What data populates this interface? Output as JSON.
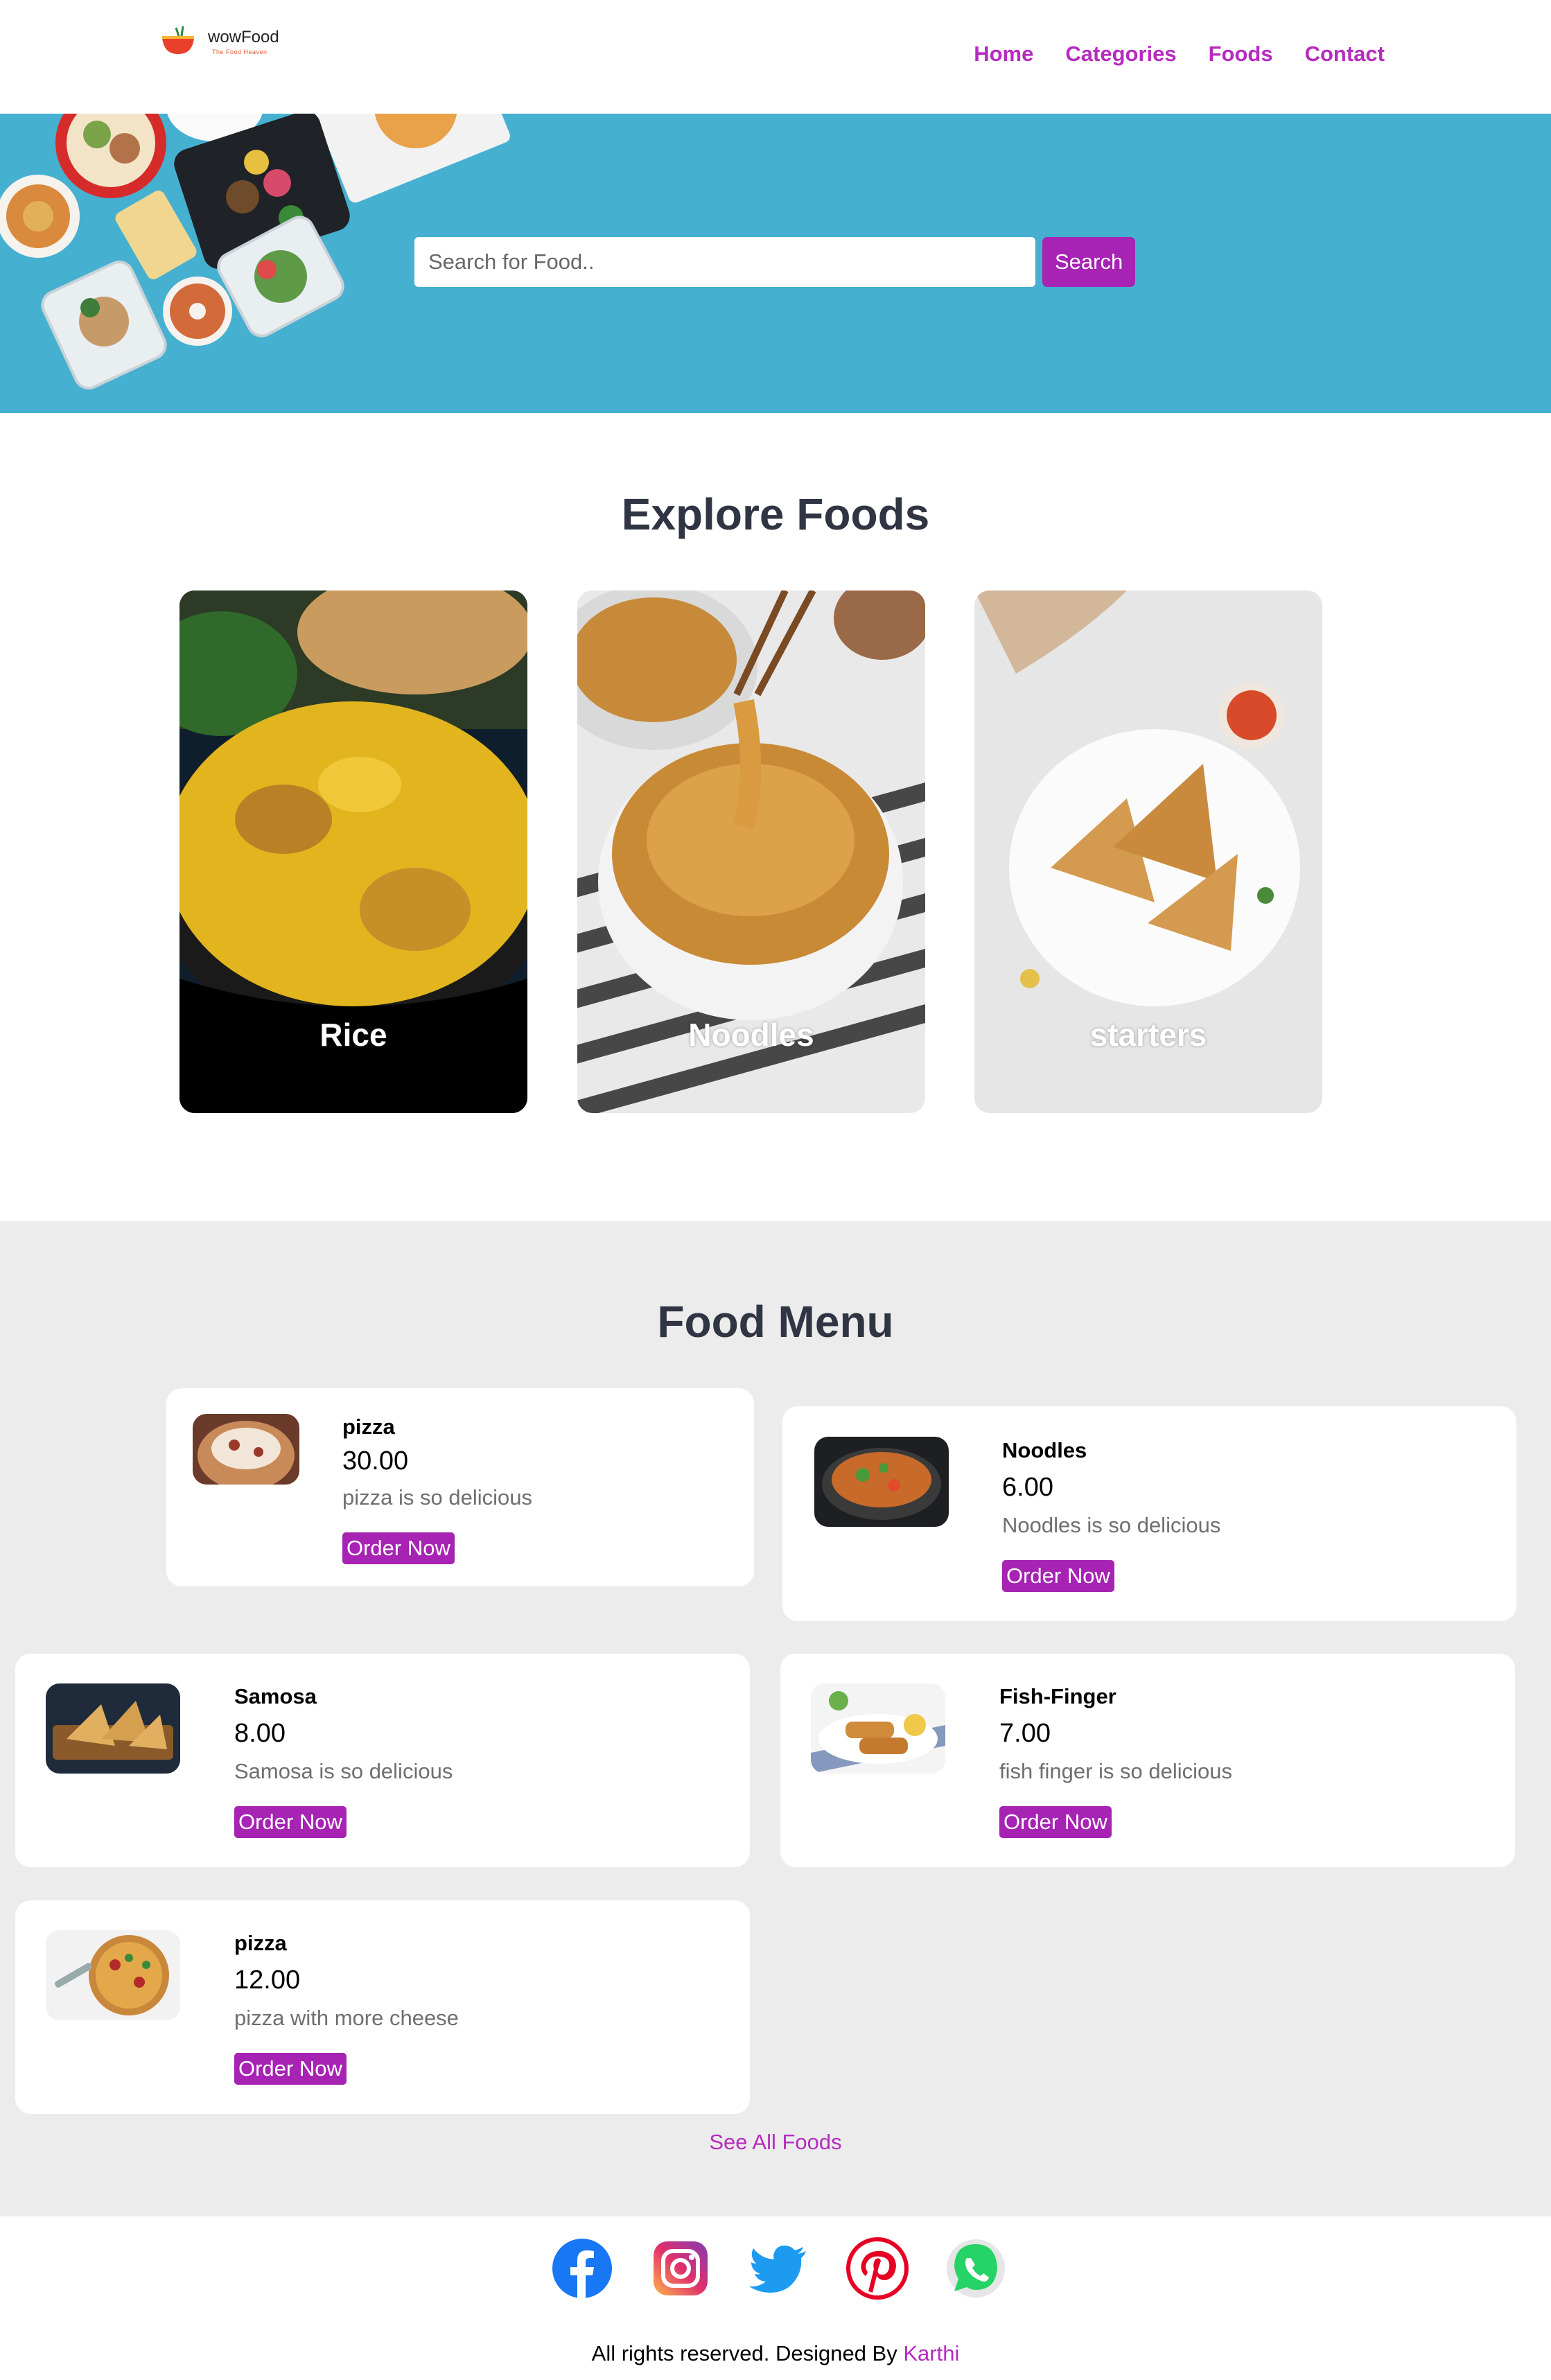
{
  "nav": {
    "logo_name": "wowFood",
    "logo_tagline": "The Food Heaven",
    "links": [
      "Home",
      "Categories",
      "Foods",
      "Contact"
    ]
  },
  "search": {
    "placeholder": "Search for Food..",
    "button": "Search"
  },
  "explore": {
    "title": "Explore Foods",
    "categories": [
      "Rice",
      "Noodles",
      "starters"
    ]
  },
  "food_menu": {
    "title": "Food Menu",
    "order_label": "Order Now",
    "items": [
      {
        "name": "pizza",
        "price": "30.00",
        "desc": "pizza is so delicious"
      },
      {
        "name": "Noodles",
        "price": "6.00",
        "desc": "Noodles is so delicious"
      },
      {
        "name": "Samosa",
        "price": "8.00",
        "desc": "Samosa is so delicious"
      },
      {
        "name": "Fish-Finger",
        "price": "7.00",
        "desc": "fish finger is so delicious"
      },
      {
        "name": "pizza",
        "price": "12.00",
        "desc": "pizza with more cheese"
      }
    ],
    "see_all": "See All Foods"
  },
  "footer": {
    "social_icons": [
      "facebook-icon",
      "instagram-icon",
      "twitter-icon",
      "pinterest-icon",
      "whatsapp-icon"
    ],
    "text_prefix": "All rights reserved. Designed By",
    "designer": "Karthi"
  },
  "colors": {
    "accent": "#a623b3",
    "hero_bg": "#46b0d1",
    "menu_bg": "#ececec"
  }
}
